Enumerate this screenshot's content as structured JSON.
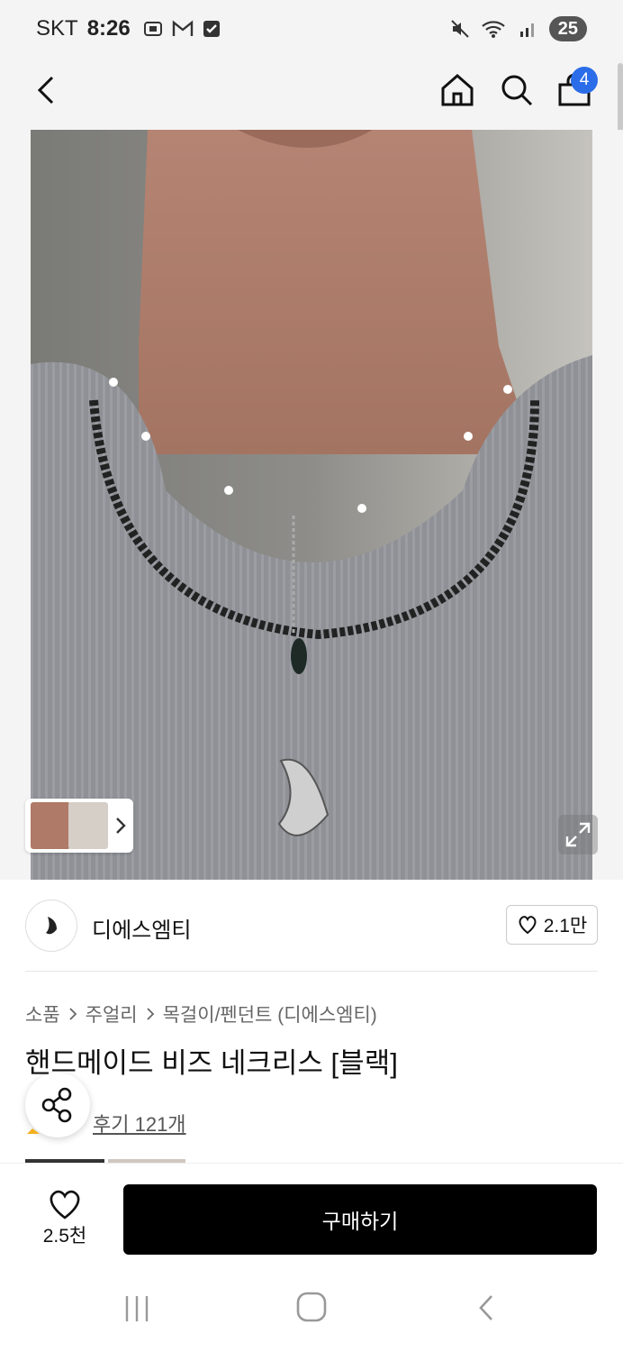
{
  "status_bar": {
    "carrier": "SKT",
    "time": "8:26",
    "battery": "25"
  },
  "header": {
    "cart_count": "4"
  },
  "brand": {
    "name": "디에스엠티",
    "like_count": "2.1만"
  },
  "breadcrumb": {
    "items": [
      "소품",
      "주얼리",
      "목걸이/펜던트 (디에스엠티)"
    ]
  },
  "product": {
    "title": "핸드메이드 비즈 네크리스 [블랙]",
    "review_link": "후기 121개"
  },
  "bottom_bar": {
    "wish_count": "2.5천",
    "buy_label": "구매하기"
  },
  "icons": [
    "back-arrow-icon",
    "home-icon",
    "search-icon",
    "shopping-bag-icon",
    "heart-icon",
    "share-icon",
    "expand-icon",
    "chevron-right-icon"
  ]
}
